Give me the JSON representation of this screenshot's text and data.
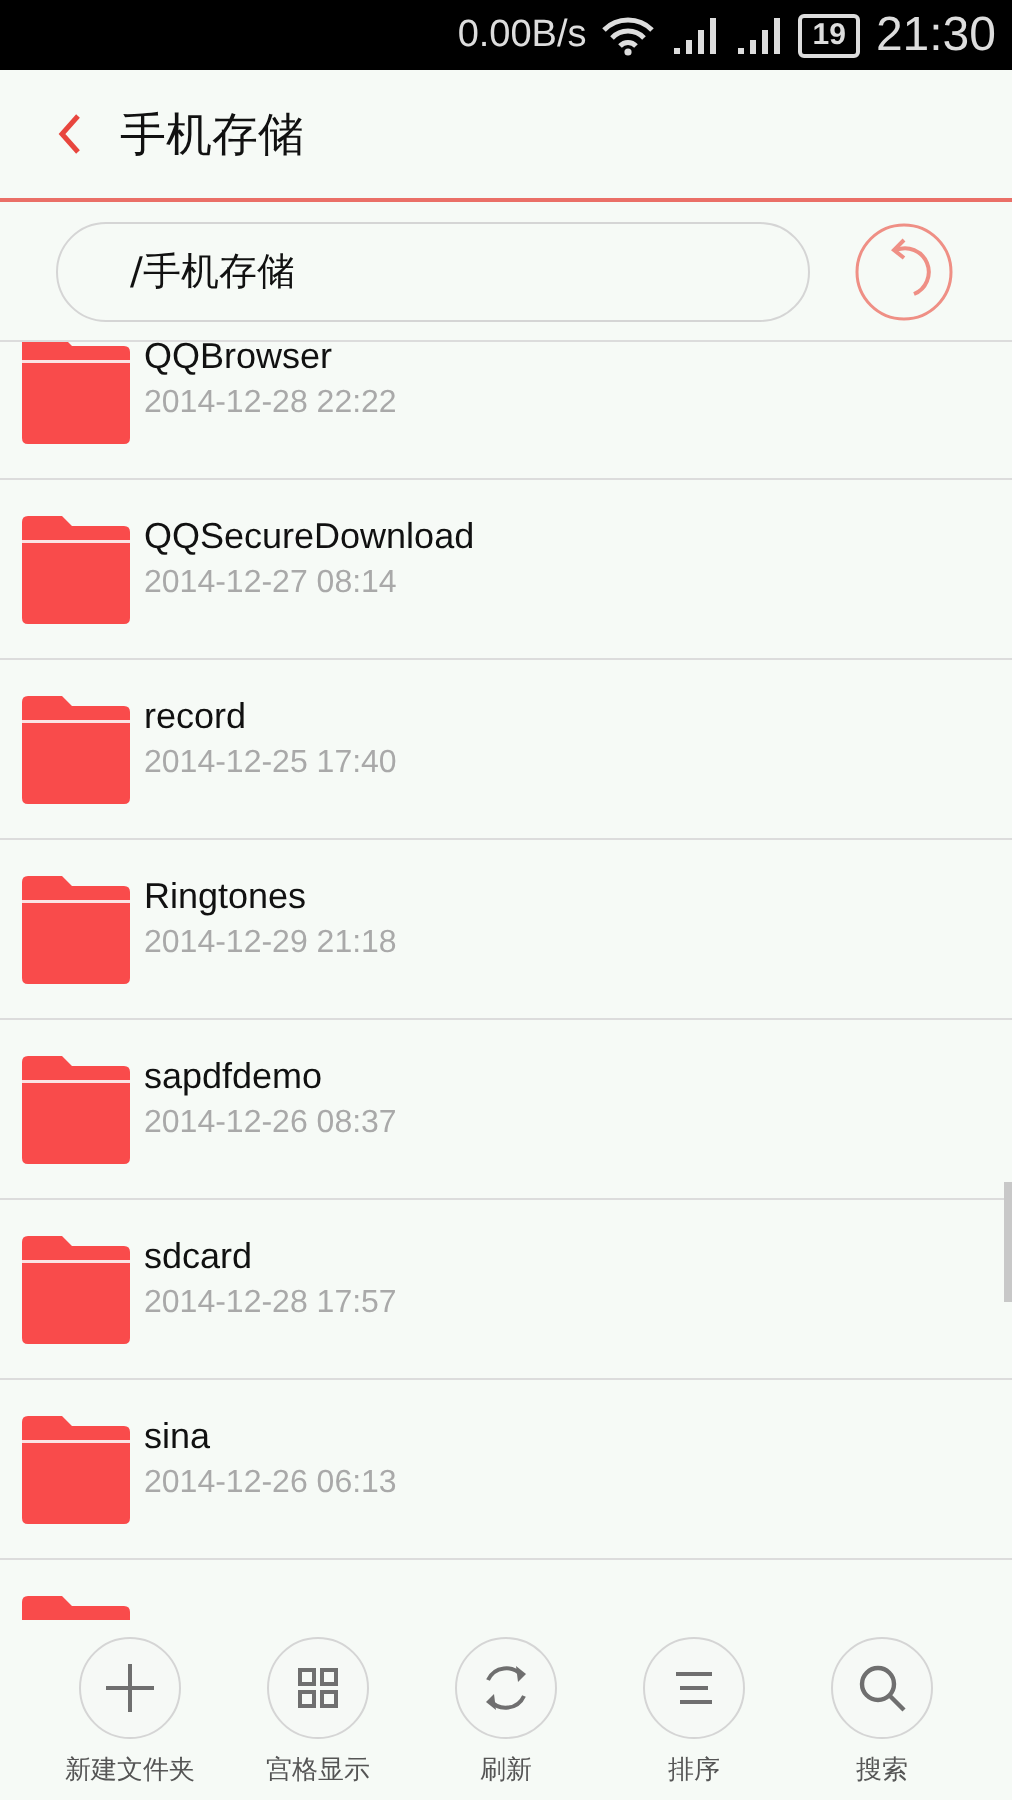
{
  "status_bar": {
    "speed": "0.00B/s",
    "battery": "19",
    "time": "21:30"
  },
  "header": {
    "title": "手机存储"
  },
  "path": {
    "value": "/手机存储"
  },
  "files": [
    {
      "kind": "folder",
      "name": "QQBrowser",
      "date": "2014-12-28 22:22"
    },
    {
      "kind": "folder",
      "name": "QQSecureDownload",
      "date": "2014-12-27 08:14"
    },
    {
      "kind": "folder",
      "name": "record",
      "date": "2014-12-25 17:40"
    },
    {
      "kind": "folder",
      "name": "Ringtones",
      "date": "2014-12-29 21:18"
    },
    {
      "kind": "folder",
      "name": "sapdfdemo",
      "date": "2014-12-26 08:37"
    },
    {
      "kind": "folder",
      "name": "sdcard",
      "date": "2014-12-28 17:57"
    },
    {
      "kind": "folder",
      "name": "sina",
      "date": "2014-12-26 06:13"
    },
    {
      "kind": "partial"
    }
  ],
  "toolbar": [
    {
      "kind": "new",
      "label": "新建文件夹"
    },
    {
      "kind": "grid",
      "label": "宫格显示"
    },
    {
      "kind": "refresh",
      "label": "刷新"
    },
    {
      "kind": "sort",
      "label": "排序"
    },
    {
      "kind": "search",
      "label": "搜索"
    }
  ]
}
